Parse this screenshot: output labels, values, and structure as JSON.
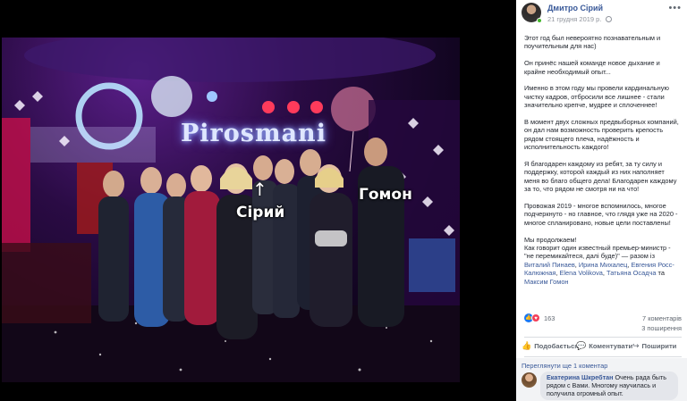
{
  "post": {
    "author": "Дмитро Сірий",
    "date": "21 грудня 2019 р.",
    "more_label": "•••",
    "paragraphs": [
      "Этот год был невероятно познавательным и поучительным для нас)",
      "Он принёс нашей команде новое дыхание и крайне необходимый опыт...",
      "Именно в этом году мы провели кардинальную чистку кадров, отбросили все лишнее - стали значительно крепче, мудрее и сплоченнее!",
      "В момент двух сложных предвыборных компаний, он дал нам возможность проверить крепость рядом стоящего плеча, надёжность и исполнительность каждого!",
      "Я благодарен каждому из ребят, за ту силу и поддержку, которой каждый из них наполняет меня во благо общего дела! Благодарен каждому за то, что рядом не смотря ни на что!",
      "Провожая 2019 - многое вспомнилось, многое подчеркнуто - но главное, что глядя уже на 2020 - многое спланировано, новые цели поставлены!"
    ],
    "closing_line_1": "Мы продолжаем!",
    "closing_line_2": "Как говорит один известный премьер-министр - \"не перемикайтеся, далі буде)\" —",
    "with_word": "разом із",
    "tagged": [
      "Виталий Пинаев",
      "Ирина Михалец",
      "Евгения Росс-Калюжная",
      "Elena Volikova",
      "Татьяна Осадча"
    ],
    "tagged_and": "та",
    "tagged_last": "Максим Гомон"
  },
  "photo": {
    "sign_text": "Pirosmani",
    "label_siryi": "Сірий",
    "label_homon": "Гомон",
    "arrow": "↑"
  },
  "reactions": {
    "like_icon": "👍",
    "love_icon": "♥",
    "count": "163",
    "comments": "7 коментарів",
    "shares": "3 поширення"
  },
  "actions": {
    "like": "Подобається",
    "comment": "Коментувати",
    "share": "Поширити"
  },
  "comments": {
    "prev_link": "Переглянути ще 1 коментар",
    "first": {
      "author": "Екатерина Шкребтан",
      "text": "Очень рада быть рядом с Вами. Многому научилась и получила огромный опыт."
    }
  },
  "colors": {
    "link": "#385898",
    "like": "#1877f2",
    "love": "#f33e58",
    "online": "#42b72a"
  }
}
